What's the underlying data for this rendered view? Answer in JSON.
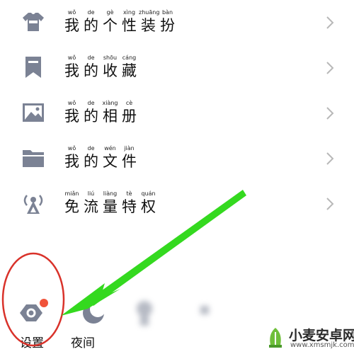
{
  "menu": {
    "items": [
      {
        "icon": "tshirt-icon",
        "pinyin": [
          "wǒ",
          "de",
          "gè",
          "xìng",
          "zhuāng",
          "bàn"
        ],
        "chars": [
          "我",
          "的",
          "个",
          "性",
          "装",
          "扮"
        ]
      },
      {
        "icon": "bookmark-icon",
        "pinyin": [
          "wǒ",
          "de",
          "shōu",
          "cáng"
        ],
        "chars": [
          "我",
          "的",
          "收",
          "藏"
        ]
      },
      {
        "icon": "image-icon",
        "pinyin": [
          "wǒ",
          "de",
          "xiàng",
          "cè"
        ],
        "chars": [
          "我",
          "的",
          "相",
          "册"
        ]
      },
      {
        "icon": "folder-icon",
        "pinyin": [
          "wǒ",
          "de",
          "wén",
          "jiàn"
        ],
        "chars": [
          "我",
          "的",
          "文",
          "件"
        ]
      },
      {
        "icon": "signal-tower-icon",
        "pinyin": [
          "miǎn",
          "liú",
          "liàng",
          "tè",
          "quán"
        ],
        "chars": [
          "免",
          "流",
          "量",
          "特",
          "权"
        ]
      }
    ]
  },
  "bottom_bar": {
    "settings_label": "设置",
    "night_label": "夜间"
  },
  "watermark": {
    "text": "小麦安卓网",
    "url": "www.xmsmjk.com"
  },
  "colors": {
    "icon": "#7b8294",
    "chevron": "#b8b8b8",
    "badge": "#f0533a",
    "arrow": "#34d91f",
    "annotation_circle": "#d9322a"
  }
}
